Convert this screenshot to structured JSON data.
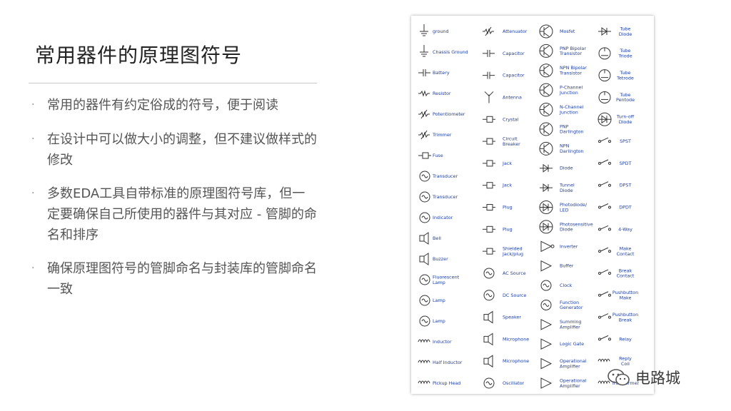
{
  "slide": {
    "title": "常用器件的原理图符号",
    "bullets": [
      "常用的器件有约定俗成的符号，便于阅读",
      "在设计中可以做大小的调整，但不建议做样式的修改",
      "多数EDA工具自带标准的原理图符号库，但一定要确保自己所使用的器件与其对应 - 管脚的命名和排序",
      "确保原理图符号的管脚命名与封装库的管脚命名一致"
    ],
    "bullet_marker": "·"
  },
  "symbol_chart": {
    "columns": [
      {
        "items": [
          {
            "label": [
              "ground"
            ],
            "icon": "ground-icon"
          },
          {
            "label": [
              "Chassis Ground"
            ],
            "icon": "chassis-ground-icon"
          },
          {
            "label": [
              "Battery"
            ],
            "icon": "battery-icon"
          },
          {
            "label": [
              "Resistor"
            ],
            "icon": "resistor-icon"
          },
          {
            "label": [
              "Potentiometer"
            ],
            "icon": "potentiometer-icon"
          },
          {
            "label": [
              "Trimmer"
            ],
            "icon": "trimmer-icon"
          },
          {
            "label": [
              "Fuse"
            ],
            "icon": "fuse-icon"
          },
          {
            "label": [
              "Transducer"
            ],
            "icon": "transducer-icon"
          },
          {
            "label": [
              "Transducer"
            ],
            "icon": "transducer-icon"
          },
          {
            "label": [
              "Indicator"
            ],
            "icon": "indicator-icon"
          },
          {
            "label": [
              "Bell"
            ],
            "icon": "bell-icon"
          },
          {
            "label": [
              "Buzzer"
            ],
            "icon": "buzzer-icon"
          },
          {
            "label": [
              "Fluorescent",
              "Lamp"
            ],
            "icon": "fluorescent-lamp-icon"
          },
          {
            "label": [
              "Lamp"
            ],
            "icon": "lamp-icon"
          },
          {
            "label": [
              "Lamp"
            ],
            "icon": "lamp-icon"
          },
          {
            "label": [
              "Inductor"
            ],
            "icon": "inductor-icon"
          },
          {
            "label": [
              "Half Inductor"
            ],
            "icon": "half-inductor-icon"
          },
          {
            "label": [
              "Pickup Head"
            ],
            "icon": "pickup-head-icon"
          }
        ]
      },
      {
        "items": [
          {
            "label": [
              "Attenuator"
            ],
            "icon": "attenuator-icon"
          },
          {
            "label": [
              "Capacitor"
            ],
            "icon": "capacitor-icon"
          },
          {
            "label": [
              "Capacitor"
            ],
            "icon": "capacitor-icon"
          },
          {
            "label": [
              "Antenna"
            ],
            "icon": "antenna-icon"
          },
          {
            "label": [
              "Crystal"
            ],
            "icon": "crystal-icon"
          },
          {
            "label": [
              "Circuit",
              "Breaker"
            ],
            "icon": "circuit-breaker-icon"
          },
          {
            "label": [
              "Jack"
            ],
            "icon": "jack-icon"
          },
          {
            "label": [
              "Jack"
            ],
            "icon": "jack-icon"
          },
          {
            "label": [
              "Plug"
            ],
            "icon": "plug-icon"
          },
          {
            "label": [
              "Plug"
            ],
            "icon": "plug-icon"
          },
          {
            "label": [
              "Shielded",
              "Jack/plug"
            ],
            "icon": "shielded-jack-icon"
          },
          {
            "label": [
              "AC Source"
            ],
            "icon": "ac-source-icon"
          },
          {
            "label": [
              "DC Source"
            ],
            "icon": "dc-source-icon"
          },
          {
            "label": [
              "Speaker"
            ],
            "icon": "speaker-icon"
          },
          {
            "label": [
              "Microphone"
            ],
            "icon": "microphone-icon"
          },
          {
            "label": [
              "Microphone"
            ],
            "icon": "microphone-icon"
          },
          {
            "label": [
              "Oscillator"
            ],
            "icon": "oscillator-icon"
          }
        ]
      },
      {
        "items": [
          {
            "label": [
              "Mosfet"
            ],
            "icon": "mosfet-icon"
          },
          {
            "label": [
              "PNP Bipolar",
              "Transistor"
            ],
            "icon": "pnp-transistor-icon"
          },
          {
            "label": [
              "NPN Bipolar",
              "Transistor"
            ],
            "icon": "npn-transistor-icon"
          },
          {
            "label": [
              "P-Channel",
              "Junction"
            ],
            "icon": "p-channel-jfet-icon"
          },
          {
            "label": [
              "N-Channel",
              "Junction"
            ],
            "icon": "n-channel-jfet-icon"
          },
          {
            "label": [
              "PNP",
              "Darlington"
            ],
            "icon": "pnp-darlington-icon"
          },
          {
            "label": [
              "NPN",
              "Darlington"
            ],
            "icon": "npn-darlington-icon"
          },
          {
            "label": [
              "Diode"
            ],
            "icon": "diode-icon"
          },
          {
            "label": [
              "Tunnel",
              "Diode"
            ],
            "icon": "tunnel-diode-icon"
          },
          {
            "label": [
              "Photodiode/",
              "LED"
            ],
            "icon": "photodiode-icon"
          },
          {
            "label": [
              "Photosensitive",
              "Diode"
            ],
            "icon": "photosensitive-diode-icon"
          },
          {
            "label": [
              "Inverter"
            ],
            "icon": "inverter-icon"
          },
          {
            "label": [
              "Buffer"
            ],
            "icon": "buffer-icon"
          },
          {
            "label": [
              "Clock"
            ],
            "icon": "clock-icon"
          },
          {
            "label": [
              "Function",
              "Generator"
            ],
            "icon": "function-generator-icon"
          },
          {
            "label": [
              "Summing",
              "Amplifier"
            ],
            "icon": "summing-amplifier-icon"
          },
          {
            "label": [
              "Logic Gate"
            ],
            "icon": "logic-gate-icon"
          },
          {
            "label": [
              "Operational",
              "Amplifier"
            ],
            "icon": "op-amp-icon"
          },
          {
            "label": [
              "Operational",
              "Amplifier"
            ],
            "icon": "op-amp-icon"
          }
        ]
      },
      {
        "items": [
          {
            "label": [
              "Tube",
              "Diode"
            ],
            "icon": "tube-diode-icon"
          },
          {
            "label": [
              "Tube",
              "Triode"
            ],
            "icon": "tube-triode-icon"
          },
          {
            "label": [
              "Tube",
              "Tetrode"
            ],
            "icon": "tube-tetrode-icon"
          },
          {
            "label": [
              "Tube",
              "Pentode"
            ],
            "icon": "tube-pentode-icon"
          },
          {
            "label": [
              "Turn-off",
              "Diode"
            ],
            "icon": "turn-off-diode-icon"
          },
          {
            "label": [
              "SPST"
            ],
            "icon": "spst-switch-icon"
          },
          {
            "label": [
              "SPDT"
            ],
            "icon": "spdt-switch-icon"
          },
          {
            "label": [
              "DPST"
            ],
            "icon": "dpst-switch-icon"
          },
          {
            "label": [
              "DPDT"
            ],
            "icon": "dpdt-switch-icon"
          },
          {
            "label": [
              "4-Way"
            ],
            "icon": "four-way-switch-icon"
          },
          {
            "label": [
              "Make",
              "Contact"
            ],
            "icon": "make-contact-icon"
          },
          {
            "label": [
              "Break",
              "Contact"
            ],
            "icon": "break-contact-icon"
          },
          {
            "label": [
              "Pushbutton",
              "Make"
            ],
            "icon": "pushbutton-make-icon"
          },
          {
            "label": [
              "Pushbutton",
              "Break"
            ],
            "icon": "pushbutton-break-icon"
          },
          {
            "label": [
              "Relay"
            ],
            "icon": "relay-icon"
          },
          {
            "label": [
              "Reply",
              "Coil"
            ],
            "icon": "reply-coil-icon"
          },
          {
            "label": [
              "Transformer"
            ],
            "icon": "transformer-icon"
          }
        ]
      }
    ]
  },
  "watermark": {
    "text": "电路城",
    "icon": "wechat-logo-icon"
  },
  "colors": {
    "label_blue": "#1f3fa0",
    "text_gray": "#555555",
    "title": "#222222"
  }
}
